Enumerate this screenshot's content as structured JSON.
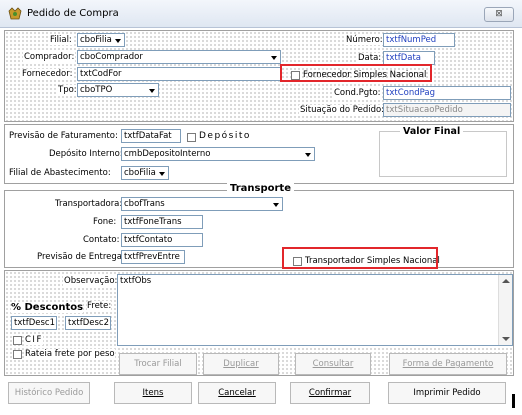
{
  "window": {
    "title": "Pedido de Compra",
    "close_label": "⊠"
  },
  "header": {
    "filial_label": "Filial:",
    "filial_value": "cboFilia",
    "comprador_label": "Comprador:",
    "comprador_value": "cboComprador",
    "fornecedor_label": "Fornecedor:",
    "fornecedor_value": "txtCodFor",
    "tipo_label": "Tpo:",
    "tipo_value": "cboTPO",
    "numero_label": "Número:",
    "numero_value": "txtfNumPed",
    "data_label": "Data:",
    "data_value": "txtfData",
    "fornecedor_sn_label": "Fornecedor Simples Nacional",
    "condpgto_label": "Cond.Pgto:",
    "condpgto_value": "txtCondPag",
    "situacao_label": "Situação do Pedido:",
    "situacao_value": "txtSituacaoPedido"
  },
  "faturamento": {
    "previsao_label": "Previsão de Faturamento:",
    "previsao_value": "txtfDataFat",
    "deposito_chk_label": "Depósito",
    "deposito_interno_label": "Depósito Interno:",
    "deposito_interno_value": "cmbDepositoInterno",
    "filial_abast_label": "Filial de Abastecimento:",
    "filial_abast_value": "cboFilia",
    "valor_final_label": "Valor Final"
  },
  "transporte": {
    "section_title": "Transporte",
    "transportadora_label": "Transportadora:",
    "transportadora_value": "cbofTrans",
    "fone_label": "Fone:",
    "fone_value": "txtfFoneTrans",
    "contato_label": "Contato:",
    "contato_value": "txtfContato",
    "previsao_entrega_label": "Previsão de Entrega:",
    "previsao_entrega_value": "txtfPrevEntre",
    "transportador_sn_label": "Transportador Simples Nacional"
  },
  "obs": {
    "observacao_label": "Observação:",
    "observacao_value": "txtfObs",
    "descontos_label": "% Descontos",
    "frete_label": "Frete:",
    "desc1_value": "txtfDesc1",
    "desc2_value": "txtfDesc2",
    "cif_label": "CIF",
    "rateia_label": "Rateia frete por peso"
  },
  "buttons": {
    "trocar_filial": "Trocar Filial",
    "duplicar": "Duplicar",
    "consultar": "Consultar",
    "forma_pagamento": "Forma de Pagamento",
    "historico": "Histórico Pedido",
    "itens": "Itens",
    "cancelar": "Cancelar",
    "confirmar": "Confirmar",
    "imprimir": "Imprimir Pedido"
  },
  "colors": {
    "highlight": "#e2262b",
    "field_text": "#1f3fbf",
    "disabled_text": "#9a9a9a"
  }
}
